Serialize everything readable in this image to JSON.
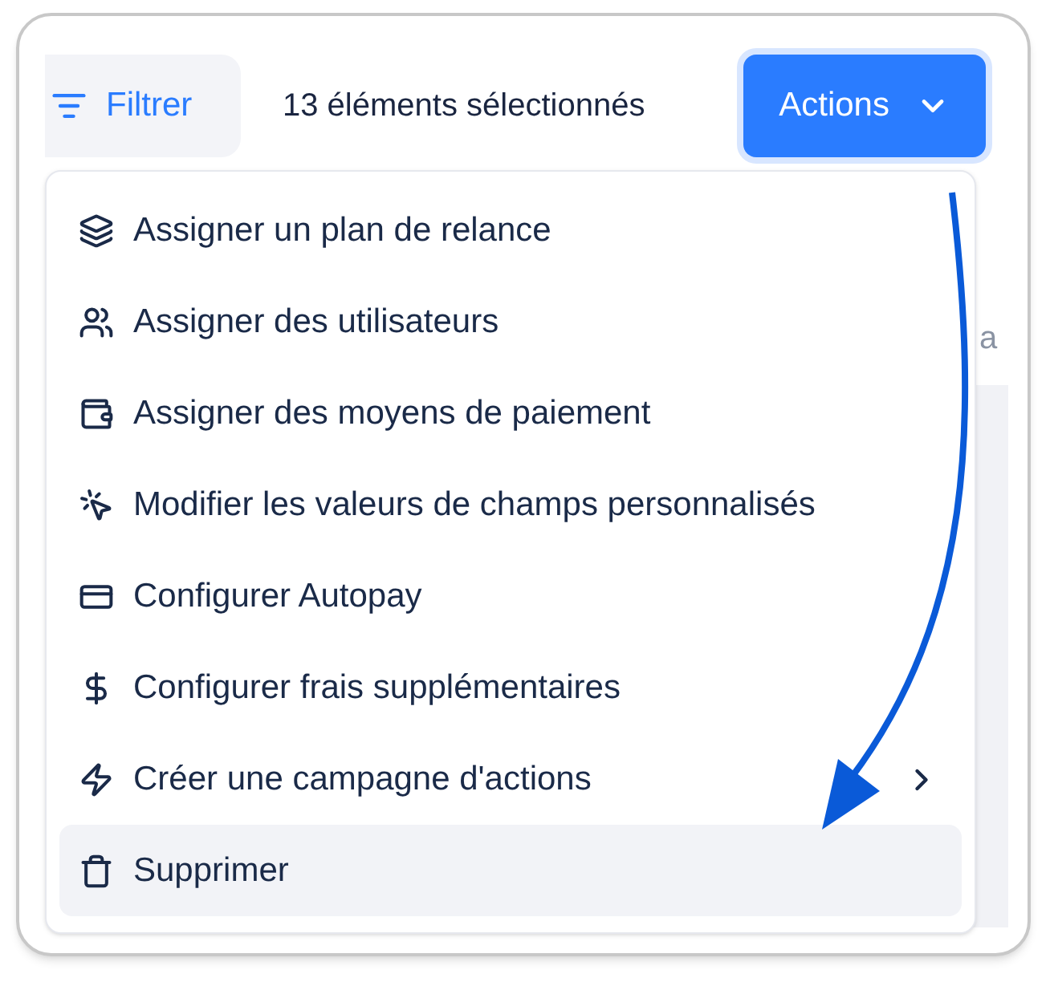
{
  "toolbar": {
    "filter_button": "Filtrer",
    "selection_count": "13 éléments sélectionnés",
    "actions_button": "Actions"
  },
  "background": {
    "column_3": "a"
  },
  "actions_menu": {
    "items": [
      {
        "label": "Assigner un plan de relance",
        "selected": false,
        "has_submenu": false
      },
      {
        "label": "Assigner des utilisateurs",
        "selected": false,
        "has_submenu": false
      },
      {
        "label": "Assigner des moyens de paiement",
        "selected": false,
        "has_submenu": false
      },
      {
        "label": "Modifier les valeurs de champs personnalisés",
        "selected": false,
        "has_submenu": false
      },
      {
        "label": "Configurer Autopay",
        "selected": false,
        "has_submenu": false
      },
      {
        "label": "Configurer frais supplémentaires",
        "selected": false,
        "has_submenu": false
      },
      {
        "label": "Créer une campagne d'actions",
        "selected": false,
        "has_submenu": true
      },
      {
        "label": "Supprimer",
        "selected": true,
        "has_submenu": false
      }
    ]
  }
}
